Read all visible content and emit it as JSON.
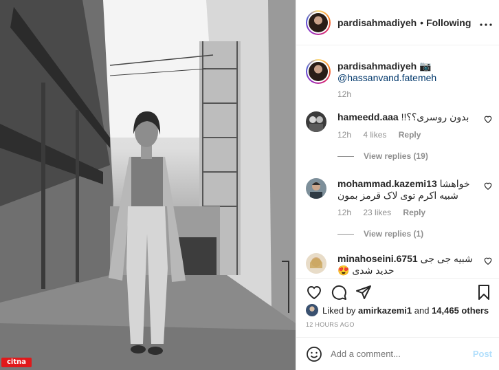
{
  "photo": {
    "alt": "Black and white street photo of a woman in a long coat",
    "watermark": "citna"
  },
  "header": {
    "username": "pardisahmadiyeh",
    "separator": "•",
    "follow_status": "Following",
    "more_icon": "more-horizontal-icon"
  },
  "caption": {
    "username": "pardisahmadiyeh",
    "camera": "📷",
    "mention": "@hassanvand.fatemeh",
    "time": "12h"
  },
  "comments": [
    {
      "username": "hameedd.aaa",
      "text": "بدون روسری؟؟!!",
      "time": "12h",
      "likes": "4 likes",
      "reply": "Reply",
      "view_replies": "View replies (19)"
    },
    {
      "username": "mohammad.kazemi13",
      "text": "خواهشا شبیه اکرم توی لاک قرمز بمون",
      "time": "12h",
      "likes": "23 likes",
      "reply": "Reply",
      "view_replies": "View replies (1)"
    },
    {
      "username": "minahoseini.6751",
      "text": "شبیه جی جی حدید شدی 😍",
      "time": "",
      "likes": "",
      "reply": "",
      "view_replies": ""
    }
  ],
  "likes": {
    "prefix": "Liked by",
    "user": "amirkazemi1",
    "and": "and",
    "count": "14,465 others"
  },
  "time_ago": "12 HOURS AGO",
  "add_comment": {
    "placeholder": "Add a comment...",
    "post_label": "Post"
  },
  "colors": {
    "link": "#00376b",
    "muted": "#8e8e8e",
    "post_disabled": "#b2dffc",
    "watermark": "#e0191b"
  }
}
